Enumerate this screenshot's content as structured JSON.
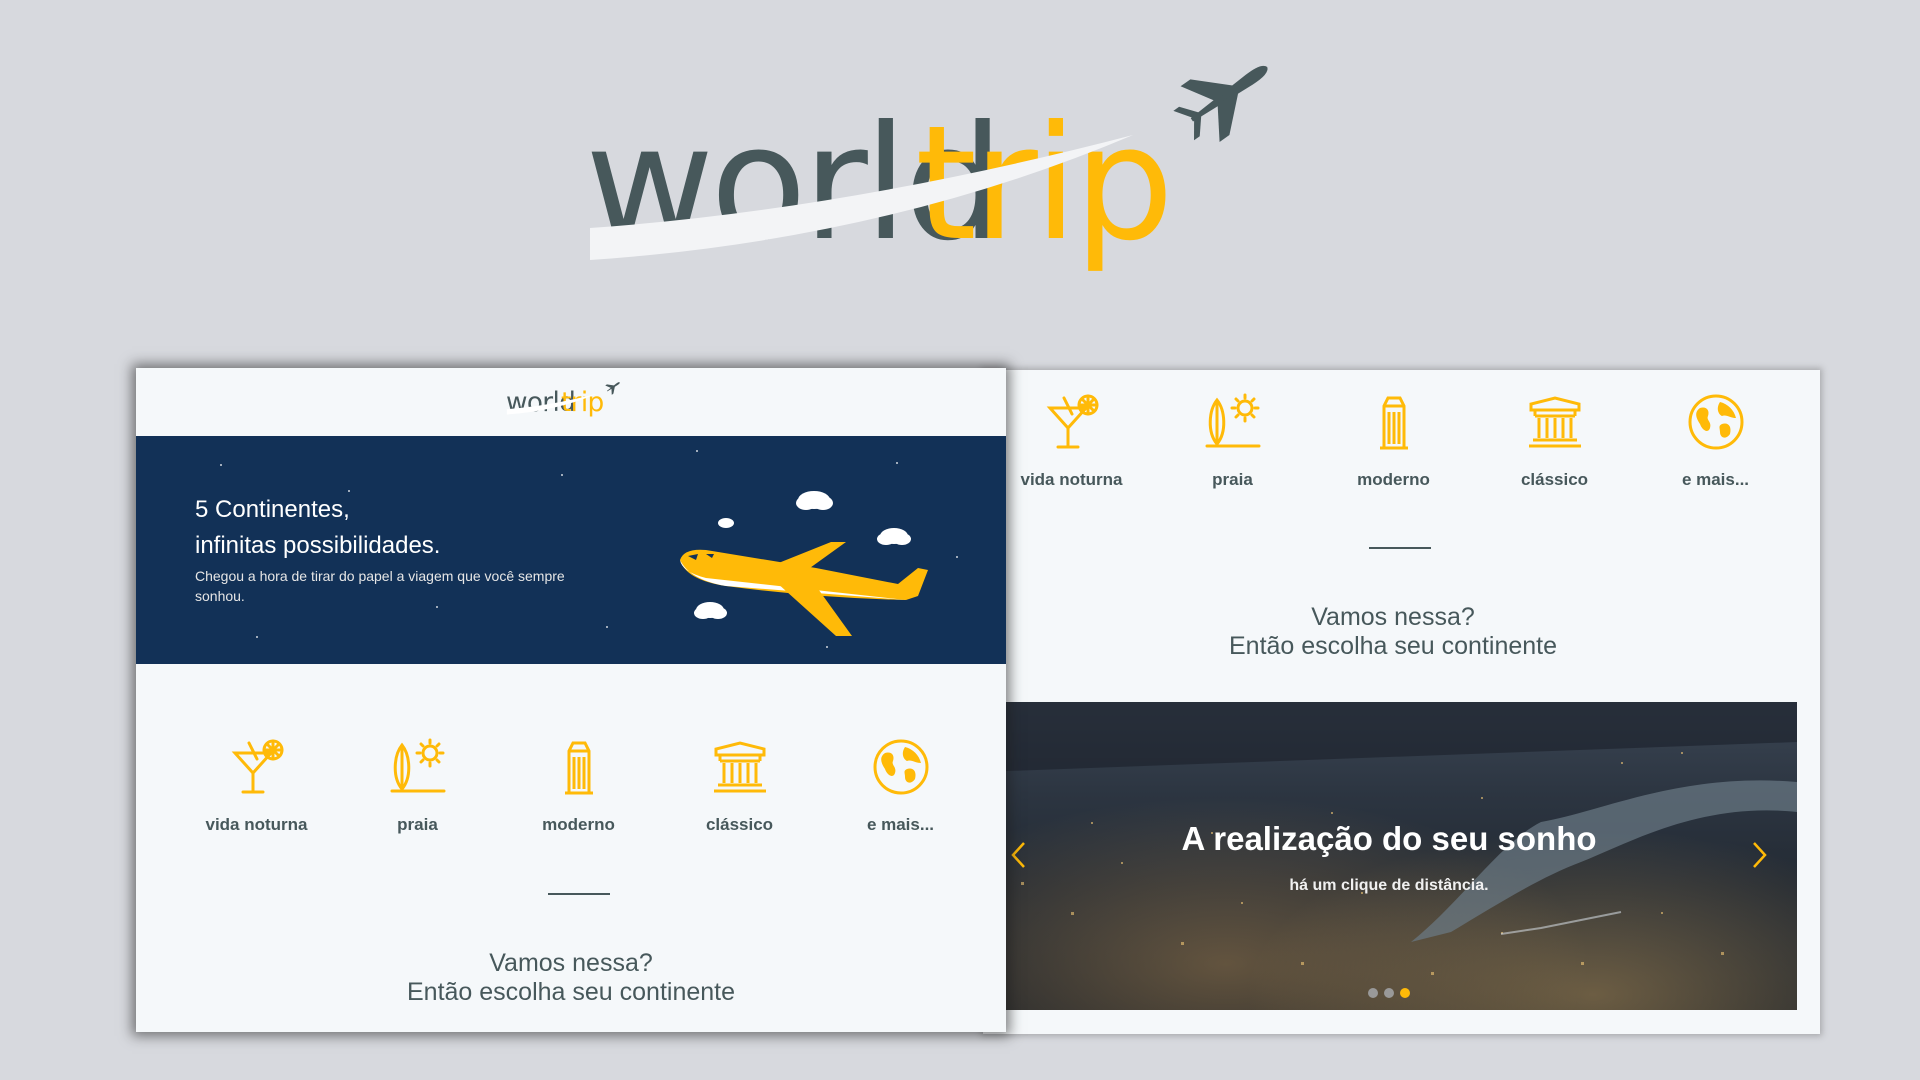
{
  "logo": {
    "world": "world",
    "trip": "trip"
  },
  "colors": {
    "accent": "#FFBA08",
    "dark_text": "#47585B",
    "banner_bg": "#123157",
    "panel_bg": "#f5f8fa",
    "page_bg": "#d7d9de"
  },
  "left_screen": {
    "banner": {
      "title_line1": "5 Continentes,",
      "title_line2": "infinitas possibilidades.",
      "subtitle": "Chegou a hora de tirar do papel a viagem que você sempre sonhou."
    }
  },
  "travel_types": [
    {
      "label": "vida noturna",
      "icon": "cocktail-icon"
    },
    {
      "label": "praia",
      "icon": "surfboard-sun-icon"
    },
    {
      "label": "moderno",
      "icon": "building-icon"
    },
    {
      "label": "clássico",
      "icon": "museum-icon"
    },
    {
      "label": "e mais...",
      "icon": "earth-globe-icon"
    }
  ],
  "cta": {
    "line1": "Vamos nessa?",
    "line2": "Então escolha seu continente"
  },
  "carousel": {
    "title": "A realização do seu sonho",
    "subtitle": "há um clique de distância.",
    "prev_icon": "chevron-left-icon",
    "next_icon": "chevron-right-icon",
    "slide_count": 3,
    "active_slide": 3
  }
}
